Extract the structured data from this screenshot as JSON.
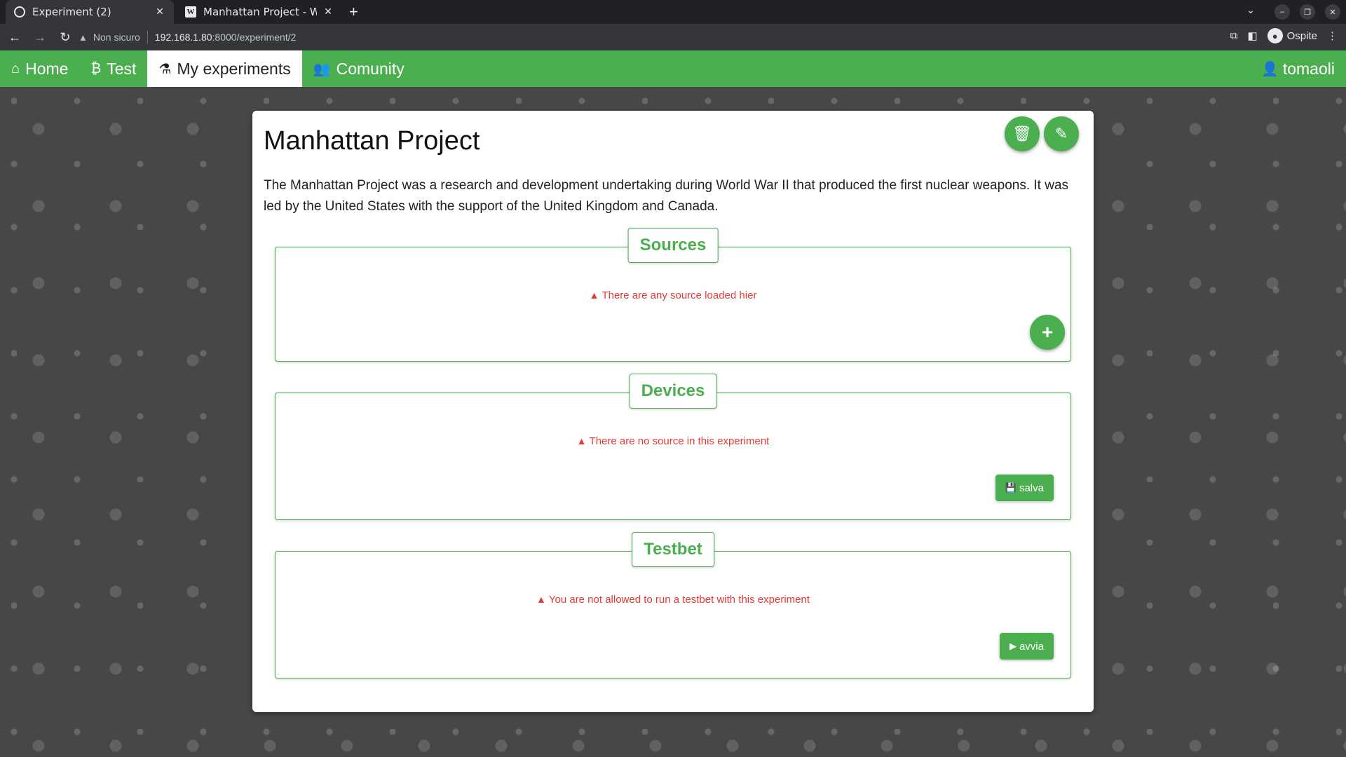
{
  "browser": {
    "tabs": [
      {
        "title": "Experiment (2)",
        "close": "✕"
      },
      {
        "title": "Manhattan Project - Wikip",
        "close": "✕"
      }
    ],
    "new_tab": "+",
    "security_label": "Non sicuro",
    "url_host": "192.168.1.80",
    "url_path": ":8000/experiment/2",
    "profile_name": "Ospite"
  },
  "nav": {
    "items": [
      {
        "label": "Home",
        "icon": "home-icon"
      },
      {
        "label": "Test",
        "icon": "bitcoin-icon"
      },
      {
        "label": "My experiments",
        "icon": "flask-icon"
      },
      {
        "label": "Comunity",
        "icon": "users-icon"
      }
    ],
    "user": "tomaoli"
  },
  "experiment": {
    "title": "Manhattan Project",
    "description": "The Manhattan Project was a research and development undertaking during World War II that produced the first nuclear weapons. It was led by the United States with the support of the United Kingdom and Canada."
  },
  "sections": {
    "sources": {
      "title": "Sources",
      "message": "There are any source loaded hier"
    },
    "devices": {
      "title": "Devices",
      "message": "There are no source in this experiment",
      "button": "salva"
    },
    "testbet": {
      "title": "Testbet",
      "message": "You are not allowed to run a testbet with this experiment",
      "button": "avvia"
    }
  },
  "colors": {
    "accent": "#4bae4f",
    "error": "#e53935"
  }
}
